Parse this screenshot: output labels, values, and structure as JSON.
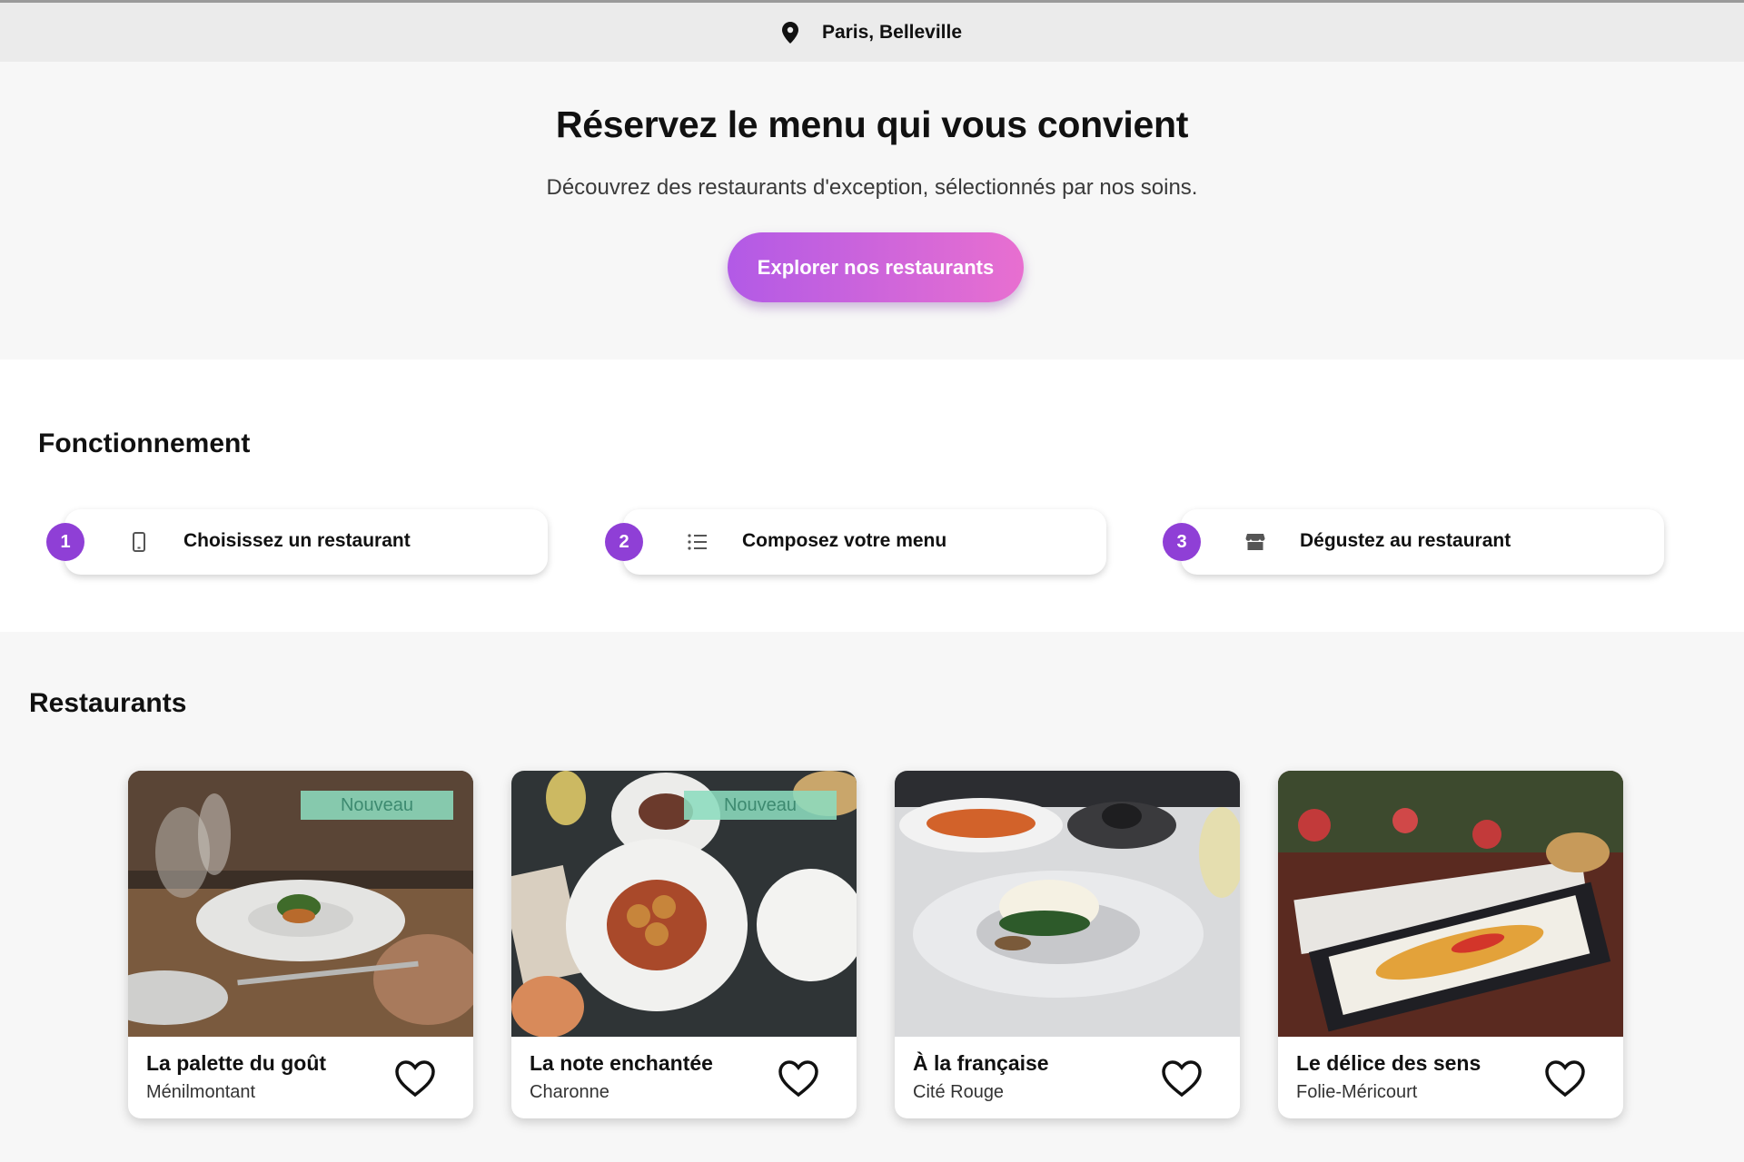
{
  "location": {
    "label": "Paris, Belleville",
    "icon": "map-pin-icon"
  },
  "hero": {
    "title": "Réservez le menu qui vous convient",
    "subtitle": "Découvrez des restaurants d'exception, sélectionnés par nos soins.",
    "cta_label": "Explorer nos restaurants"
  },
  "how_it_works": {
    "title": "Fonctionnement",
    "steps": [
      {
        "number": "1",
        "label": "Choisissez un restaurant",
        "icon": "smartphone-icon"
      },
      {
        "number": "2",
        "label": "Composez votre menu",
        "icon": "list-icon"
      },
      {
        "number": "3",
        "label": "Dégustez au restaurant",
        "icon": "storefront-icon"
      }
    ]
  },
  "restaurants": {
    "title": "Restaurants",
    "items": [
      {
        "name": "La palette du goût",
        "area": "Ménilmontant",
        "badge": "Nouveau"
      },
      {
        "name": "La note enchantée",
        "area": "Charonne",
        "badge": "Nouveau"
      },
      {
        "name": "À la française",
        "area": "Cité Rouge",
        "badge": ""
      },
      {
        "name": "Le délice des sens",
        "area": "Folie-Méricourt",
        "badge": ""
      }
    ]
  },
  "colors": {
    "accent": "#8f3fd6",
    "cta_start": "#b25ae6",
    "cta_end": "#e86fd0",
    "badge": "#8cdcbe"
  }
}
